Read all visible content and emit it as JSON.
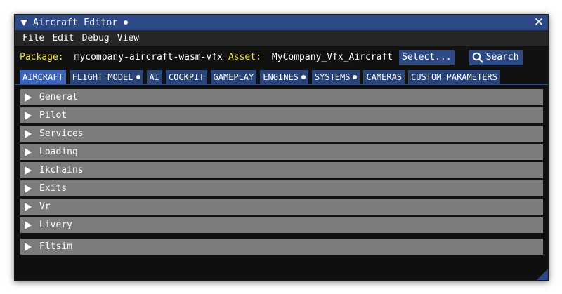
{
  "window": {
    "title": "Aircraft Editor",
    "close_glyph": "✕"
  },
  "menu": [
    {
      "label": "File"
    },
    {
      "label": "Edit"
    },
    {
      "label": "Debug"
    },
    {
      "label": "View"
    }
  ],
  "package_bar": {
    "package_label": "Package:",
    "package_value": "mycompany-aircraft-wasm-vfx",
    "asset_label": "Asset:",
    "asset_value": "MyCompany_Vfx_Aircraft",
    "select_label": "Select...",
    "search_label": "Search"
  },
  "tabs": [
    {
      "label": "AIRCRAFT"
    },
    {
      "label": "FLIGHT MODEL"
    },
    {
      "label": "AI"
    },
    {
      "label": "COCKPIT"
    },
    {
      "label": "GAMEPLAY"
    },
    {
      "label": "ENGINES"
    },
    {
      "label": "SYSTEMS"
    },
    {
      "label": "CAMERAS"
    },
    {
      "label": "CUSTOM PARAMETERS"
    }
  ],
  "sections": [
    {
      "label": "General"
    },
    {
      "label": "Pilot"
    },
    {
      "label": "Services"
    },
    {
      "label": "Loading"
    },
    {
      "label": "Ikchains"
    },
    {
      "label": "Exits"
    },
    {
      "label": "Vr"
    },
    {
      "label": "Livery"
    },
    {
      "label": "Fltsim"
    }
  ],
  "colors": {
    "accent": "#2e4a86",
    "active_tab": "#3d64b8",
    "label_yellow": "#f2e03c",
    "section_gray": "#7c7c7c",
    "background": "#0f0f0f"
  },
  "icons": {
    "search": "magnifier-icon",
    "collapse": "triangle-down-icon",
    "expand": "triangle-right-icon",
    "close": "close-icon",
    "modified": "dot-icon"
  }
}
